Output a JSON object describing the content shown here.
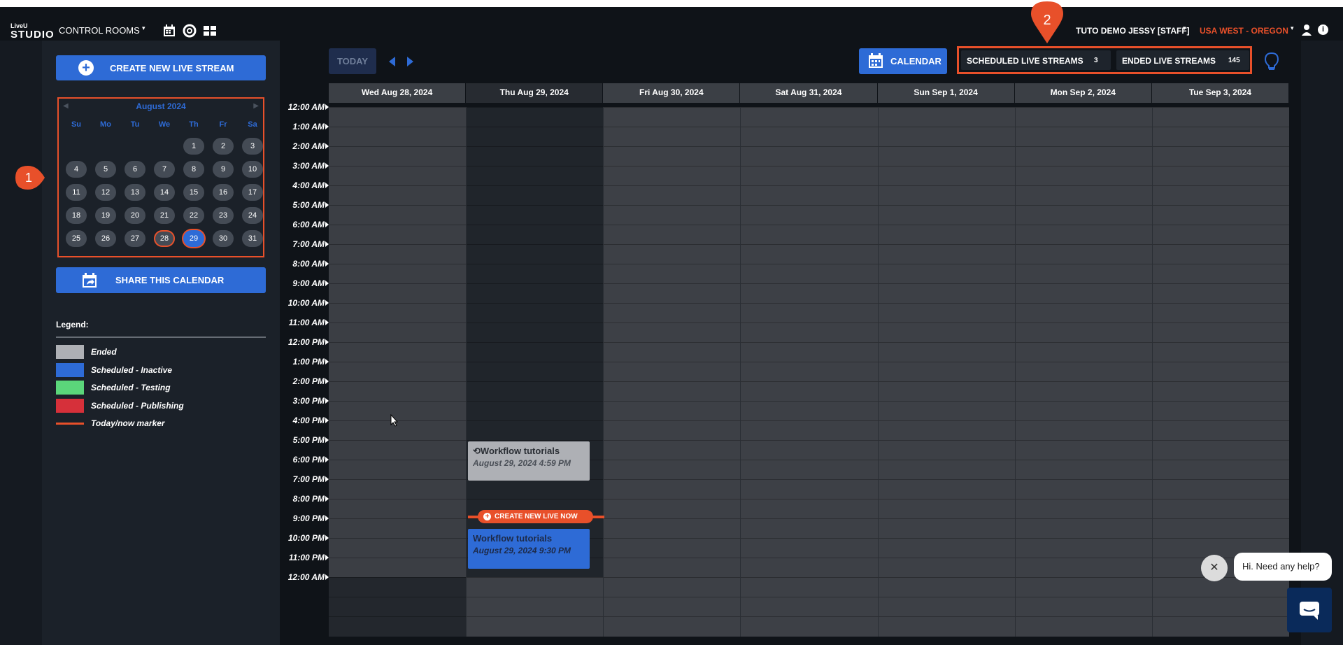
{
  "nav": {
    "logo_top": "LiveU",
    "logo_bottom": "STUDIO",
    "control_rooms": "CONTROL ROOMS",
    "user": "TUTO DEMO JESSY [STAFF]",
    "region": "USA WEST - OREGON"
  },
  "sidebar": {
    "create_button": "CREATE NEW LIVE STREAM",
    "share_button": "SHARE THIS CALENDAR",
    "minical": {
      "title": "August 2024",
      "dow": [
        "Su",
        "Mo",
        "Tu",
        "We",
        "Th",
        "Fr",
        "Sa"
      ],
      "days": [
        "1",
        "2",
        "3",
        "4",
        "5",
        "6",
        "7",
        "8",
        "9",
        "10",
        "11",
        "12",
        "13",
        "14",
        "15",
        "16",
        "17",
        "18",
        "19",
        "20",
        "21",
        "22",
        "23",
        "24",
        "25",
        "26",
        "27",
        "28",
        "29",
        "30",
        "31"
      ],
      "today": "28",
      "selected": "29"
    },
    "legend": {
      "title": "Legend:",
      "items": [
        {
          "label": "Ended",
          "color": "#aeb0b5"
        },
        {
          "label": "Scheduled - Inactive",
          "color": "#2e6bd6"
        },
        {
          "label": "Scheduled - Testing",
          "color": "#5bd67a"
        },
        {
          "label": "Scheduled - Publishing",
          "color": "#d6303a"
        },
        {
          "label": "Today/now marker",
          "color": "#e8502a"
        }
      ]
    }
  },
  "annotations": {
    "badge1": "1",
    "badge2": "2"
  },
  "toolbar": {
    "today": "TODAY",
    "calendar": "CALENDAR",
    "scheduled_label": "SCHEDULED LIVE STREAMS",
    "scheduled_count": "3",
    "ended_label": "ENDED LIVE STREAMS",
    "ended_count": "145"
  },
  "calendar": {
    "days": [
      "Wed Aug 28, 2024",
      "Thu Aug 29, 2024",
      "Fri Aug 30, 2024",
      "Sat Aug 31, 2024",
      "Sun Sep 1, 2024",
      "Mon Sep 2, 2024",
      "Tue Sep 3, 2024"
    ],
    "times": [
      "12:00 AM",
      "1:00 AM",
      "2:00 AM",
      "3:00 AM",
      "4:00 AM",
      "5:00 AM",
      "6:00 AM",
      "7:00 AM",
      "8:00 AM",
      "9:00 AM",
      "10:00 AM",
      "11:00 AM",
      "12:00 PM",
      "1:00 PM",
      "2:00 PM",
      "3:00 PM",
      "4:00 PM",
      "5:00 PM",
      "6:00 PM",
      "7:00 PM",
      "8:00 PM",
      "9:00 PM",
      "10:00 PM",
      "11:00 PM",
      "12:00 AM"
    ],
    "events": [
      {
        "title": "Workflow tutorials",
        "date": "August 29, 2024 4:59 PM",
        "status": "Ended"
      },
      {
        "title": "Workflow tutorials",
        "date": "August 29, 2024 9:30 PM",
        "status": "Scheduled - Inactive"
      }
    ],
    "now_button": "CREATE NEW LIVE NOW"
  },
  "chat": {
    "message": "Hi. Need any help?"
  },
  "colors": {
    "accent": "#2e6bd6",
    "marker": "#e8502a"
  }
}
